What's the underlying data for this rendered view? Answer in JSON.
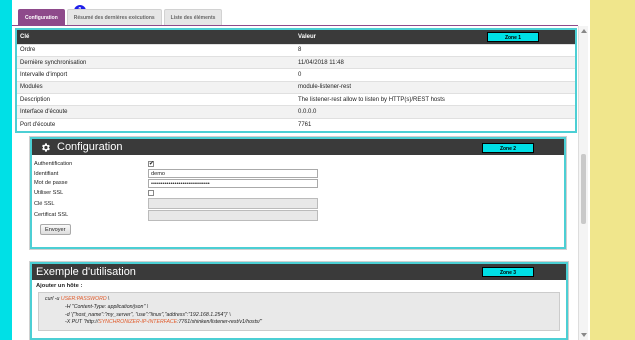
{
  "tabs": [
    {
      "label": "Configuration",
      "active": true
    },
    {
      "label": "Résumé des dernières exécutions",
      "active": false
    },
    {
      "label": "Liste des éléments",
      "active": false
    }
  ],
  "tab_badge": "1",
  "zones": {
    "z1": "Zone 1",
    "z2": "Zone 2",
    "z3": "Zone 3"
  },
  "info_table": {
    "headers": [
      "Clé",
      "Valeur"
    ],
    "rows": [
      [
        "Ordre",
        "8"
      ],
      [
        "Dernière synchronisation",
        "11/04/2018 11:48"
      ],
      [
        "Intervalle d'import",
        "0"
      ],
      [
        "Modules",
        "module-listener-rest"
      ],
      [
        "Description",
        "The listener-rest allow to listen by HTTP(s)/REST hosts"
      ],
      [
        "Interface d'écoute",
        "0.0.0.0"
      ],
      [
        "Port d'écoute",
        "7761"
      ]
    ]
  },
  "config": {
    "title": "Configuration",
    "fields": {
      "auth_label": "Authentification",
      "id_label": "Identifiant",
      "id_value": "demo",
      "pwd_label": "Mot de passe",
      "pwd_value": "••••••••••••••••••••••••••••••",
      "ssl_label": "Utiliser SSL",
      "sslkey_label": "Clé SSL",
      "sslcert_label": "Certificat SSL"
    },
    "submit": "Envoyer"
  },
  "example": {
    "title": "Exemple d'utilisation",
    "subtitle": "Ajouter un hôte :",
    "l1a": "curl -u ",
    "l1b": "USER:PASSWORD",
    "l1c": " \\",
    "l2": "-H \"Content-Type: application/json\" \\",
    "l3": "-d '{\"host_name\":\"my_server\", \"use\":\"linux\",\"address\":\"192.168.1.254\"}' \\",
    "l4a": "-X PUT \"http://",
    "l4b": "SYNCHRONIZER-IP-INTERFACE",
    "l4c": ":7761/shinken/listener-rest/v1/hosts/\""
  },
  "colors": {
    "background": "#00e0e6",
    "active_tab": "#8e4a8b",
    "badge": "#2020e8",
    "side_panel": "#f0e68c"
  }
}
